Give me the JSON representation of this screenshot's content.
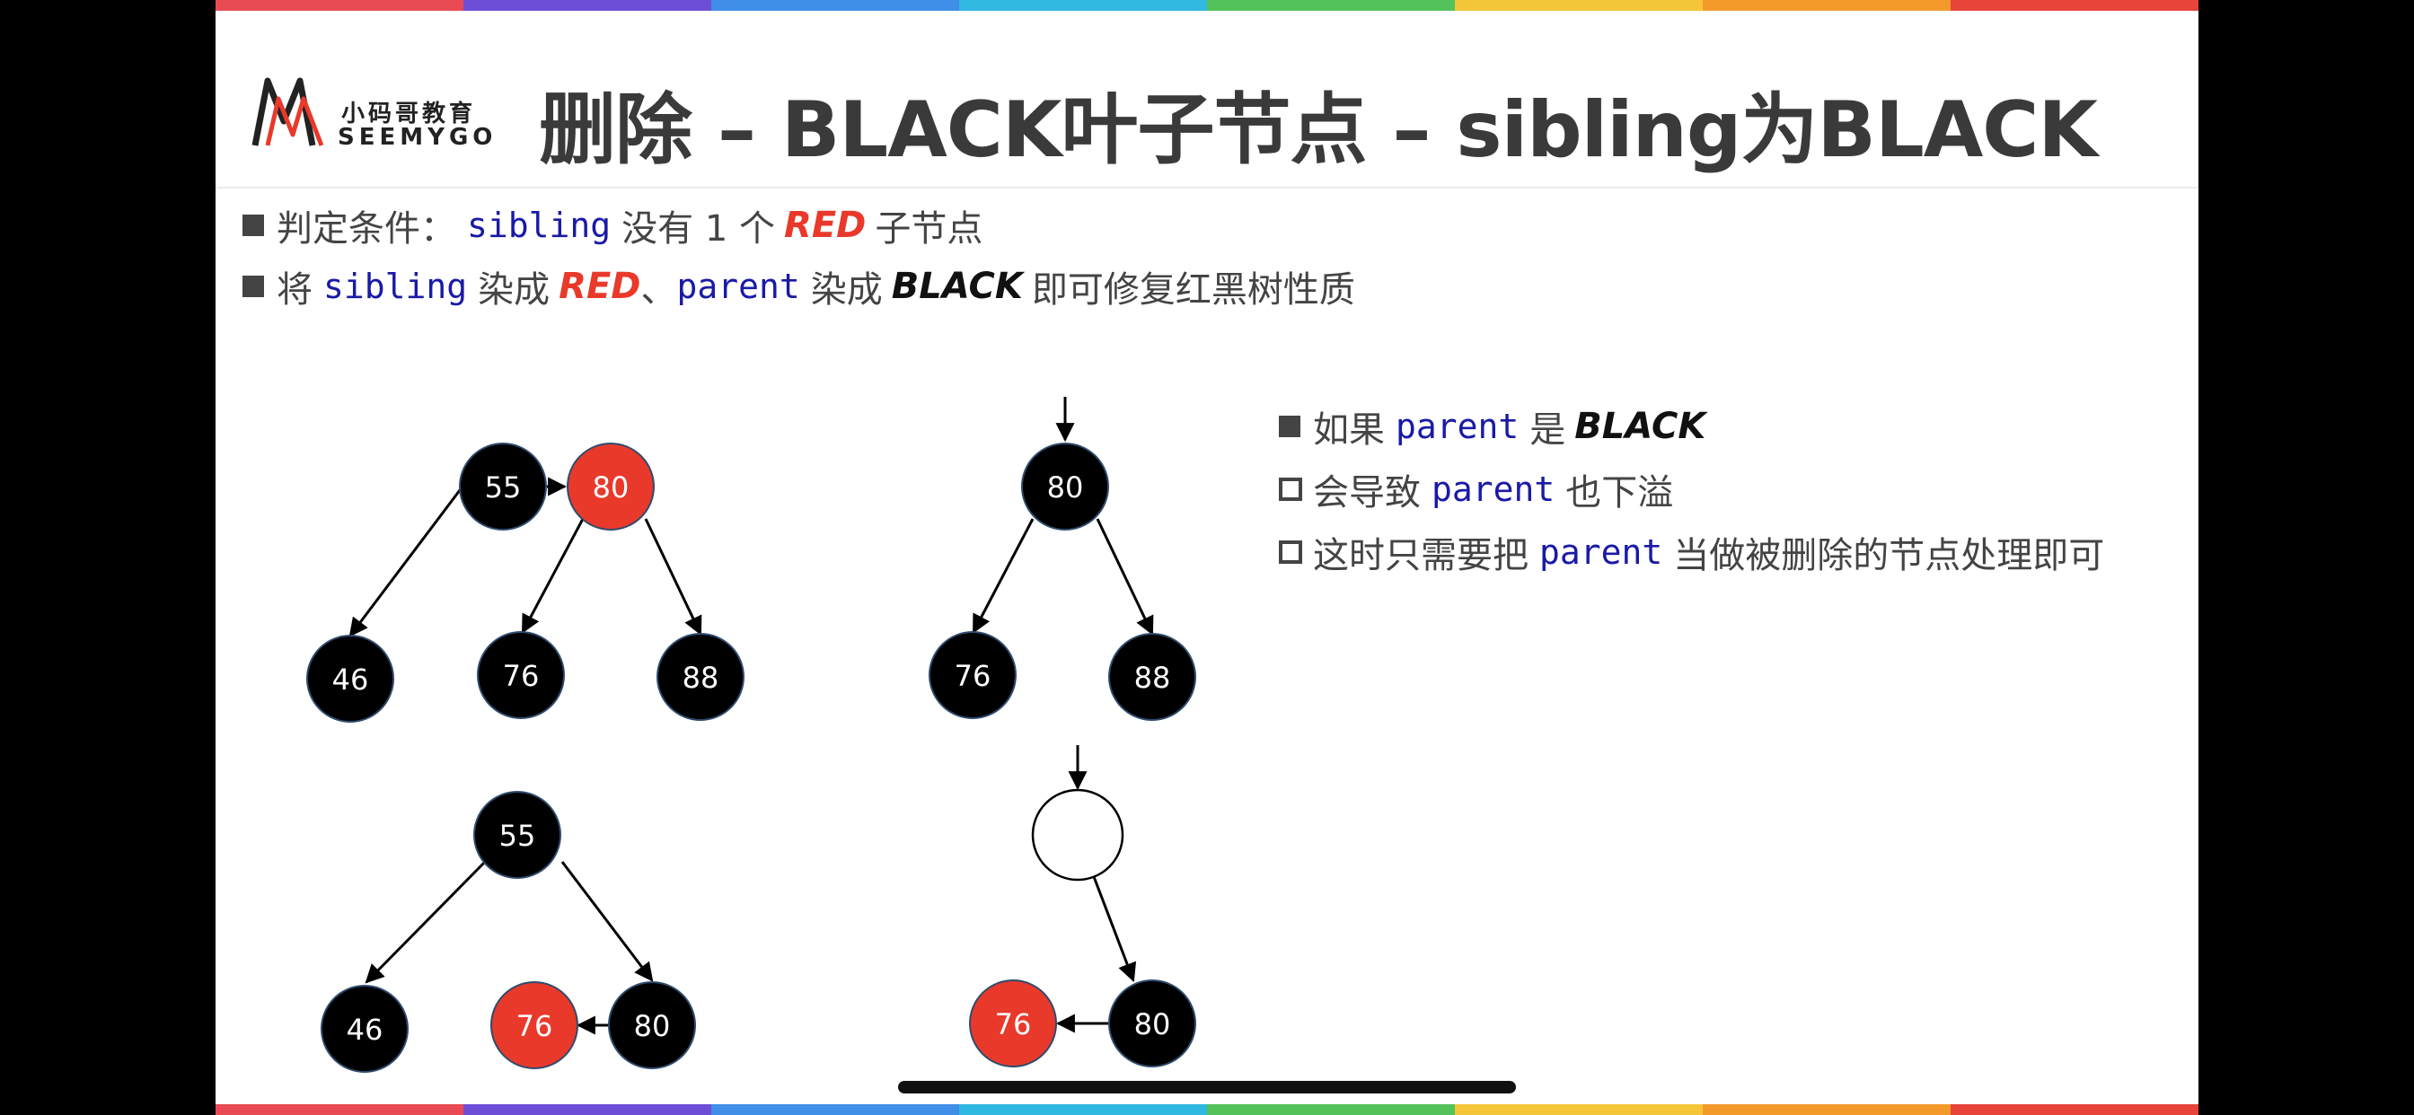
{
  "logo": {
    "cn": "小码哥教育",
    "en": "SEEMYGO"
  },
  "title": "删除 – BLACK叶子节点 – sibling为BLACK",
  "bullets": {
    "b1": {
      "p1": "判定条件：",
      "code1": "sibling",
      "p2": "没有 1 个",
      "red": "RED",
      "p3": "子节点"
    },
    "b2": {
      "p1": "将",
      "code1": "sibling",
      "p2": "染成",
      "red": "RED",
      "p3": "、",
      "code2": "parent",
      "p4": "染成",
      "black": "BLACK",
      "p5": "即可修复红黑树性质"
    },
    "b3": {
      "p1": "如果",
      "code1": "parent",
      "p2": "是",
      "black": "BLACK"
    },
    "b4": {
      "p1": "会导致",
      "code1": "parent",
      "p2": "也下溢"
    },
    "b5": {
      "p1": "这时只需要把",
      "code1": "parent",
      "p2": "当做被删除的节点处理即可"
    }
  },
  "colors": {
    "red_node": "#e8392b",
    "black_node": "#000000",
    "code": "#1a1aa6",
    "rainbow": [
      "#e94a54",
      "#6c4fd6",
      "#3f8ee8",
      "#2fb8e0",
      "#53c25a",
      "#f5c53a",
      "#f39a2b",
      "#e9443a"
    ]
  },
  "diagrams": {
    "tree1": {
      "n55": "55",
      "n80": "80",
      "n46": "46",
      "n76": "76",
      "n88": "88"
    },
    "tree2": {
      "n80": "80",
      "n76": "76",
      "n88": "88"
    },
    "tree3": {
      "n55": "55",
      "n46": "46",
      "n76": "76",
      "n80": "80"
    },
    "tree4": {
      "n76": "76",
      "n80": "80"
    }
  }
}
